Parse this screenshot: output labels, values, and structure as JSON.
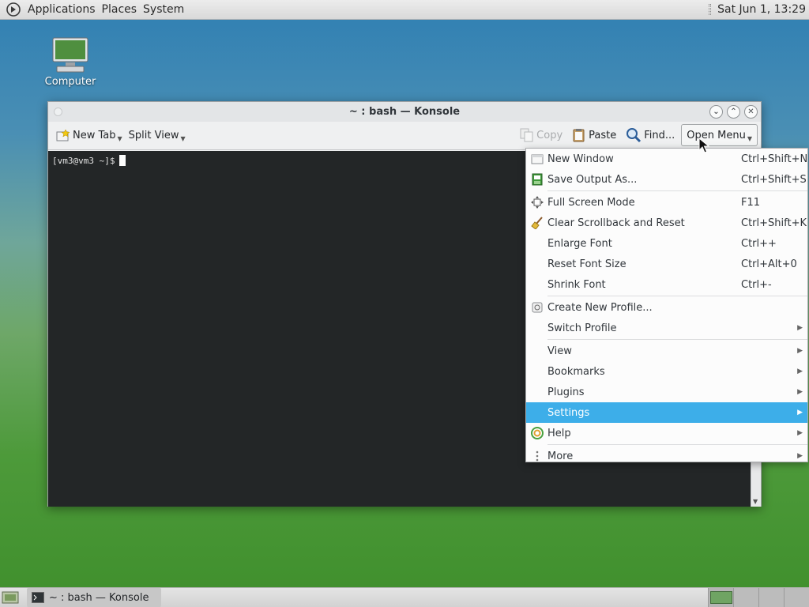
{
  "top_panel": {
    "menus": [
      "Applications",
      "Places",
      "System"
    ],
    "clock": "Sat Jun  1, 13:29"
  },
  "desktop": {
    "icons": [
      {
        "label": "Computer",
        "icon": "computer-icon"
      }
    ]
  },
  "window": {
    "title": "~ : bash — Konsole",
    "toolbar": {
      "new_tab": "New Tab",
      "split_view": "Split View",
      "copy": "Copy",
      "paste": "Paste",
      "find": "Find...",
      "open_menu": "Open Menu"
    },
    "terminal": {
      "prompt": "[vm3@vm3 ~]$"
    }
  },
  "menu": {
    "items": [
      {
        "label": "New Window",
        "shortcut": "Ctrl+Shift+N",
        "icon": "new-window-icon"
      },
      {
        "label": "Save Output As...",
        "shortcut": "Ctrl+Shift+S",
        "icon": "save-output-icon"
      },
      {
        "label": "Full Screen Mode",
        "shortcut": "F11",
        "icon": "fullscreen-icon"
      },
      {
        "label": "Clear Scrollback and Reset",
        "shortcut": "Ctrl+Shift+K",
        "icon": "broom-icon"
      },
      {
        "label": "Enlarge Font",
        "shortcut": "Ctrl++"
      },
      {
        "label": "Reset Font Size",
        "shortcut": "Ctrl+Alt+0"
      },
      {
        "label": "Shrink Font",
        "shortcut": "Ctrl+-"
      },
      {
        "label": "Create New Profile...",
        "icon": "new-profile-icon"
      },
      {
        "label": "Switch Profile",
        "submenu": true
      },
      {
        "label": "View",
        "submenu": true
      },
      {
        "label": "Bookmarks",
        "submenu": true
      },
      {
        "label": "Plugins",
        "submenu": true
      },
      {
        "label": "Settings",
        "submenu": true,
        "highlighted": true
      },
      {
        "label": "Help",
        "submenu": true,
        "icon": "help-icon"
      },
      {
        "label": "More",
        "submenu": true,
        "icon": "more-icon"
      }
    ]
  },
  "taskbar": {
    "task_label": "~ : bash — Konsole",
    "workspaces_count": 4,
    "active_workspace": 1
  },
  "colors": {
    "highlight": "#3daee9",
    "terminal_bg": "#232627"
  }
}
